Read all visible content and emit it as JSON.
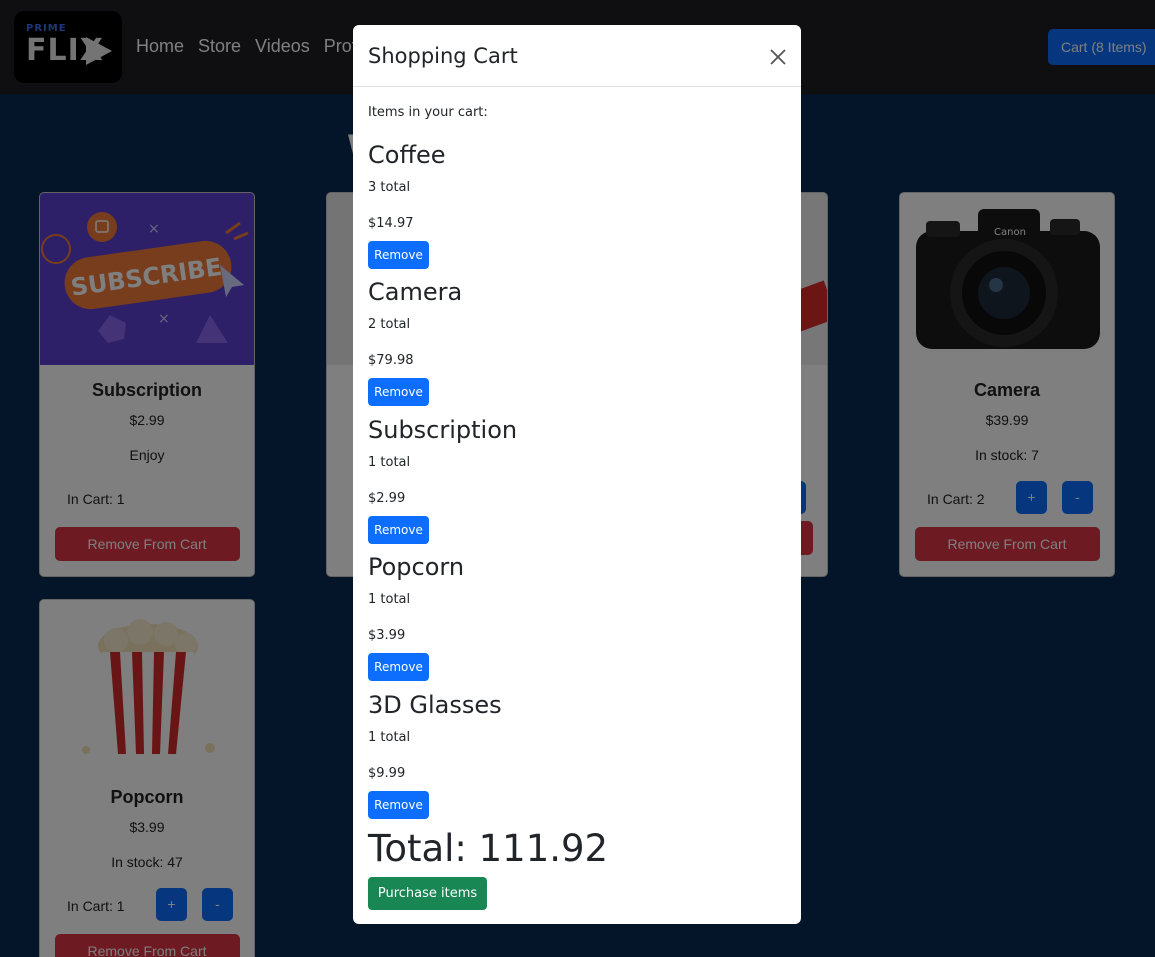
{
  "navbar": {
    "logo_prime": "PRIME",
    "logo_flix": "FLIX",
    "links": [
      "Home",
      "Store",
      "Videos",
      "Prof"
    ],
    "cart_button": "Cart (8 Items)"
  },
  "page": {
    "title_fragment": "W"
  },
  "cards": [
    {
      "title": "Subscription",
      "price": "$2.99",
      "description": "Enjoy",
      "in_cart": "In Cart: 1",
      "remove_label": "Remove From Cart",
      "image": "subscribe-banner",
      "image_text": "SUBSCRIBE"
    },
    {
      "title": "Camera",
      "price": "$39.99",
      "description": "In stock: 7",
      "in_cart": "In Cart: 2",
      "plus_label": "+",
      "minus_label": "-",
      "remove_label": "Remove From Cart",
      "image": "camera",
      "image_text": "Canon"
    },
    {
      "title": "Popcorn",
      "price": "$3.99",
      "description": "In stock: 47",
      "in_cart": "In Cart: 1",
      "plus_label": "+",
      "minus_label": "-",
      "remove_label": "Remove From Cart",
      "image": "popcorn"
    }
  ],
  "modal": {
    "title": "Shopping Cart",
    "intro": "Items in your cart:",
    "items": [
      {
        "name": "Coffee",
        "qty": "3 total",
        "price": "$14.97",
        "remove": "Remove"
      },
      {
        "name": "Camera",
        "qty": "2 total",
        "price": "$79.98",
        "remove": "Remove"
      },
      {
        "name": "Subscription",
        "qty": "1 total",
        "price": "$2.99",
        "remove": "Remove"
      },
      {
        "name": "Popcorn",
        "qty": "1 total",
        "price": "$3.99",
        "remove": "Remove"
      },
      {
        "name": "3D Glasses",
        "qty": "1 total",
        "price": "$9.99",
        "remove": "Remove"
      }
    ],
    "total": "Total: 111.92",
    "purchase": "Purchase items"
  },
  "colors": {
    "primary": "#0d6efd",
    "danger": "#dc3545",
    "success": "#198754",
    "page_bg": "#0a2a52",
    "navbar_bg": "#1e1e22"
  }
}
